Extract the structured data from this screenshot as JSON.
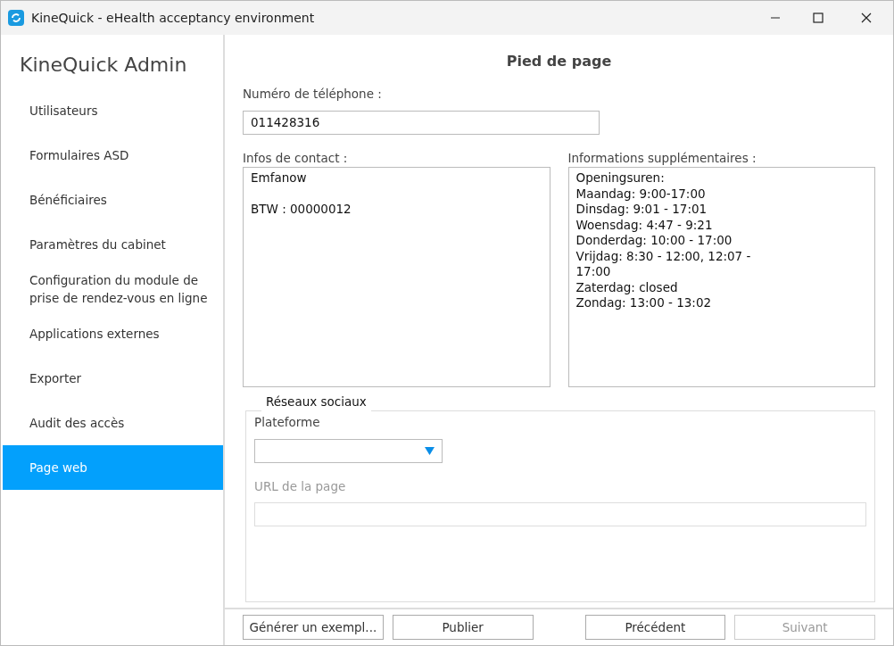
{
  "window": {
    "title": "KineQuick - eHealth acceptancy environment"
  },
  "sidebar": {
    "title": "KineQuick Admin",
    "items": [
      {
        "label": "Utilisateurs",
        "selected": false
      },
      {
        "label": "Formulaires ASD",
        "selected": false
      },
      {
        "label": "Bénéficiaires",
        "selected": false
      },
      {
        "label": "Paramètres du cabinet",
        "selected": false
      },
      {
        "label": "Configuration du module de prise de rendez-vous en ligne",
        "selected": false
      },
      {
        "label": "Applications externes",
        "selected": false
      },
      {
        "label": "Exporter",
        "selected": false
      },
      {
        "label": "Audit des accès",
        "selected": false
      },
      {
        "label": "Page web",
        "selected": true
      }
    ]
  },
  "page": {
    "title": "Pied de page",
    "phone": {
      "label": "Numéro de téléphone :",
      "value": "011428316"
    },
    "contact": {
      "label": "Infos de contact :",
      "value": "Emfanow\n\nBTW : 00000012"
    },
    "extra": {
      "label": "Informations supplémentaires :",
      "value": "Openingsuren:\nMaandag: 9:00-17:00\nDinsdag: 9:01 - 17:01\nWoensdag: 4:47 - 9:21\nDonderdag: 10:00 - 17:00\nVrijdag: 8:30 - 12:00, 12:07 - 17:00\nZaterdag: closed\nZondag: 13:00 - 13:02"
    },
    "social": {
      "legend": "Réseaux sociaux",
      "platform_label": "Plateforme",
      "url_label": "URL de la page",
      "url_disabled": true
    }
  },
  "buttons": [
    {
      "label": "Générer un exempl...",
      "disabled": false
    },
    {
      "label": "Publier",
      "disabled": false
    },
    {
      "label": "Précédent",
      "disabled": false
    },
    {
      "label": "Suivant",
      "disabled": true
    }
  ]
}
